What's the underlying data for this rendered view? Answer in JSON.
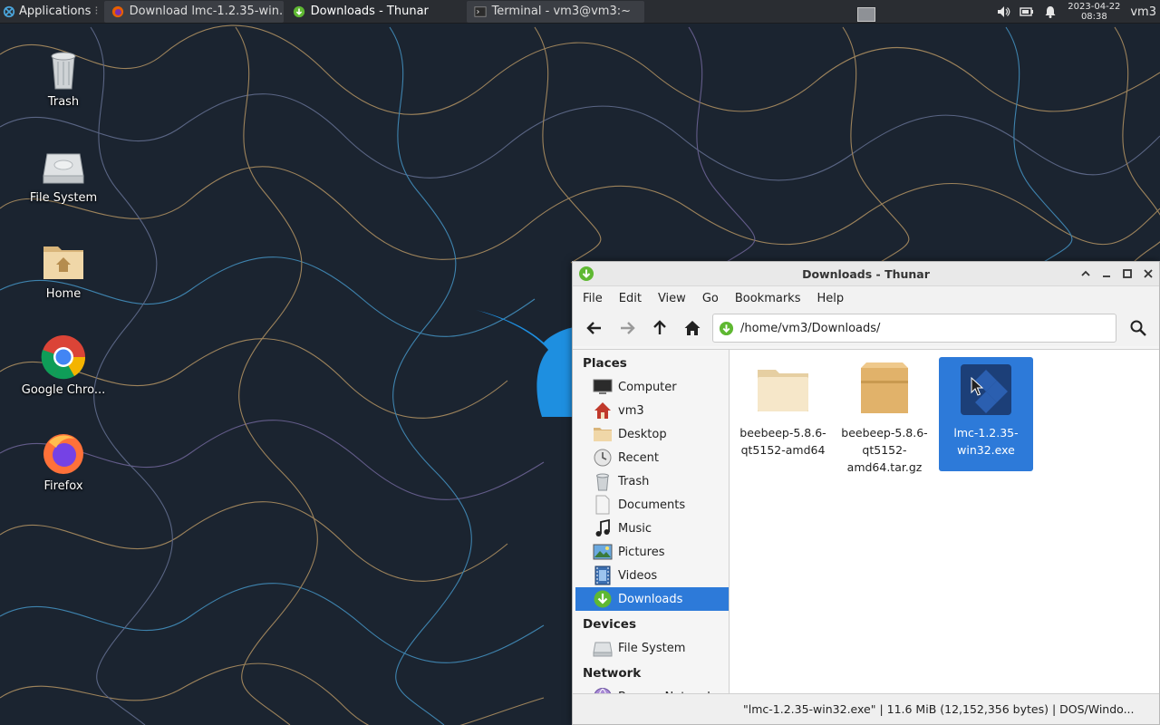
{
  "panel": {
    "applications_label": "Applications",
    "tasks": [
      {
        "label": "Download lmc-1.2.35-win..."
      },
      {
        "label": "Downloads - Thunar"
      },
      {
        "label": "Terminal - vm3@vm3:~"
      }
    ],
    "clock_date": "2023-04-22",
    "clock_time": "08:38",
    "user": "vm3",
    "tray_icons": [
      "volume-icon",
      "battery-icon",
      "notification-bell-icon"
    ]
  },
  "desktop": {
    "icons": [
      {
        "label": "Trash",
        "icon": "trash-icon"
      },
      {
        "label": "File System",
        "icon": "drive-icon"
      },
      {
        "label": "Home",
        "icon": "home-folder-icon"
      },
      {
        "label": "Google Chro...",
        "icon": "chrome-icon"
      },
      {
        "label": "Firefox",
        "icon": "firefox-icon"
      }
    ]
  },
  "thunar": {
    "title": "Downloads - Thunar",
    "menu": [
      "File",
      "Edit",
      "View",
      "Go",
      "Bookmarks",
      "Help"
    ],
    "location": "/home/vm3/Downloads/",
    "sidebar": {
      "places_title": "Places",
      "places": [
        {
          "label": "Computer",
          "icon": "computer-icon"
        },
        {
          "label": "vm3",
          "icon": "home-icon"
        },
        {
          "label": "Desktop",
          "icon": "desktop-folder-icon"
        },
        {
          "label": "Recent",
          "icon": "recent-icon"
        },
        {
          "label": "Trash",
          "icon": "trash-icon"
        },
        {
          "label": "Documents",
          "icon": "documents-icon"
        },
        {
          "label": "Music",
          "icon": "music-icon"
        },
        {
          "label": "Pictures",
          "icon": "pictures-icon"
        },
        {
          "label": "Videos",
          "icon": "videos-icon"
        },
        {
          "label": "Downloads",
          "icon": "downloads-icon",
          "active": true
        }
      ],
      "devices_title": "Devices",
      "devices": [
        {
          "label": "File System",
          "icon": "drive-icon"
        }
      ],
      "network_title": "Network",
      "network": [
        {
          "label": "Browse Network",
          "icon": "network-icon"
        }
      ]
    },
    "files": [
      {
        "line1": "beebeep-5.8.6-",
        "line2": "qt5152-amd64",
        "line3": "",
        "icon": "folder-icon"
      },
      {
        "line1": "beebeep-5.8.6-",
        "line2": "qt5152-",
        "line3": "amd64.tar.gz",
        "icon": "archive-icon"
      },
      {
        "line1": "lmc-1.2.35-",
        "line2": "win32.exe",
        "line3": "",
        "icon": "exe-icon",
        "selected": true
      }
    ],
    "status": "\"lmc-1.2.35-win32.exe\"  |  11.6 MiB (12,152,356 bytes)  |  DOS/Windo..."
  },
  "colors": {
    "selection": "#2d7ad9",
    "panel_bg": "#2a2d32",
    "wallpaper_bg": "#1b2430"
  }
}
